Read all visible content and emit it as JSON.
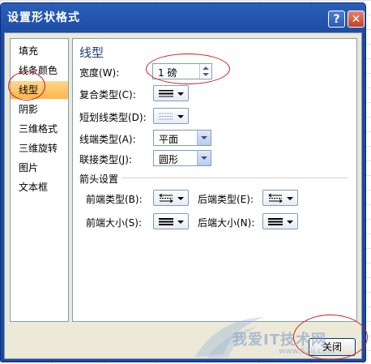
{
  "window": {
    "title": "设置形状格式",
    "help_label": "?",
    "close_label": "✕"
  },
  "nav": {
    "items": [
      {
        "label": "填充",
        "selected": false
      },
      {
        "label": "线条颜色",
        "selected": false
      },
      {
        "label": "线型",
        "selected": true
      },
      {
        "label": "阴影",
        "selected": false
      },
      {
        "label": "三维格式",
        "selected": false
      },
      {
        "label": "三维旋转",
        "selected": false
      },
      {
        "label": "图片",
        "selected": false
      },
      {
        "label": "文本框",
        "selected": false
      }
    ]
  },
  "panel": {
    "title": "线型",
    "width": {
      "label": "宽度(W):",
      "value": "1 磅"
    },
    "compound": {
      "label": "复合类型(C):",
      "icon": "compound-line-icon"
    },
    "dash": {
      "label": "短划线类型(D):",
      "icon": "dash-line-icon"
    },
    "cap": {
      "label": "线端类型(A):",
      "value": "平面"
    },
    "join": {
      "label": "联接类型(J):",
      "value": "圆形"
    },
    "arrows": {
      "section_label": "箭头设置",
      "begin_type": {
        "label": "前端类型(B):",
        "icon": "arrow-type-icon"
      },
      "end_type": {
        "label": "后端类型(E):",
        "icon": "arrow-type-icon"
      },
      "begin_size": {
        "label": "前端大小(S):",
        "icon": "arrow-size-icon"
      },
      "end_size": {
        "label": "后端大小(N):",
        "icon": "arrow-size-icon"
      }
    }
  },
  "footer": {
    "close_label": "关闭"
  },
  "watermark": {
    "text": "我爱IT技术网",
    "url": "www.52ij.com"
  },
  "colors": {
    "title_bar": "#1d4aa0",
    "client_bg": "#ece9d8",
    "selected_item": "#ffc15e",
    "annotation": "#cc1f1f"
  }
}
